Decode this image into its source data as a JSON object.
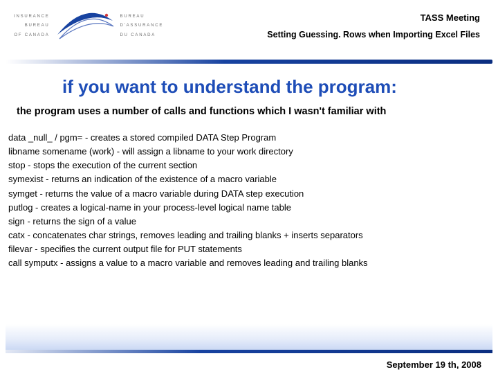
{
  "header": {
    "logo_left_lines": [
      "INSURANCE",
      "BUREAU",
      "OF CANADA"
    ],
    "logo_right_lines": [
      "BUREAU",
      "D'ASSURANCE",
      "DU CANADA"
    ],
    "meeting_title": "TASS Meeting",
    "subtitle": "Setting Guessing. Rows when Importing Excel Files"
  },
  "slide": {
    "title": "if you want to understand the program:",
    "intro": "the program uses a number of calls and functions which I wasn't familiar with",
    "items": [
      "data _null_ / pgm=  - creates a stored compiled DATA Step Program",
      "libname somename (work) - will assign a libname to your work directory",
      "stop - stops the execution of the current section",
      "symexist - returns an indication of the existence of a macro variable",
      "symget  - returns the value of a macro variable during DATA step execution",
      "putlog - creates a logical-name in your process-level logical name table",
      "sign - returns the sign of a value",
      "catx - concatenates char strings, removes leading and trailing blanks + inserts separators",
      "filevar - specifies the current output file for PUT statements",
      "call symputx - assigns a value to a macro variable and removes leading and trailing blanks"
    ]
  },
  "footer": {
    "date": "September 19 th, 2008"
  },
  "colors": {
    "title_blue": "#1e4db7",
    "divider_blue": "#0b2e80"
  }
}
